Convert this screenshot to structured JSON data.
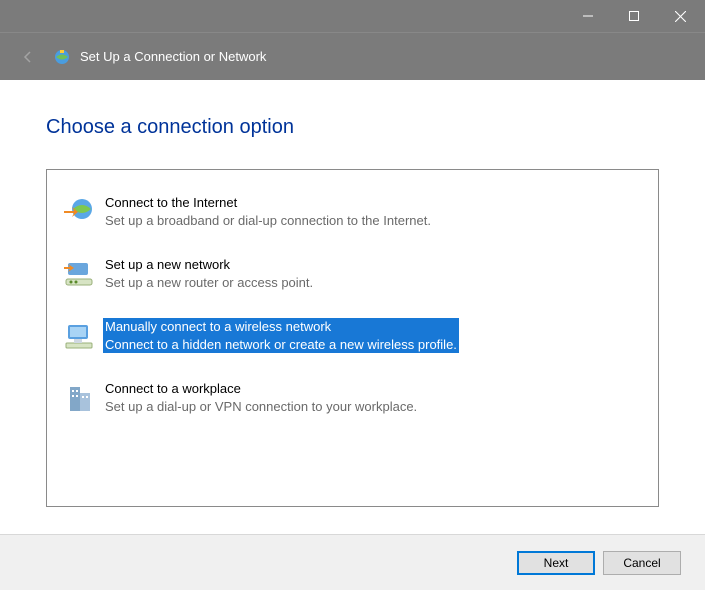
{
  "window": {
    "title": "Set Up a Connection or Network"
  },
  "page": {
    "heading": "Choose a connection option"
  },
  "options": [
    {
      "title": "Connect to the Internet",
      "desc": "Set up a broadband or dial-up connection to the Internet.",
      "selected": false
    },
    {
      "title": "Set up a new network",
      "desc": "Set up a new router or access point.",
      "selected": false
    },
    {
      "title": "Manually connect to a wireless network",
      "desc": "Connect to a hidden network or create a new wireless profile.",
      "selected": true
    },
    {
      "title": "Connect to a workplace",
      "desc": "Set up a dial-up or VPN connection to your workplace.",
      "selected": false
    }
  ],
  "buttons": {
    "next": "Next",
    "cancel": "Cancel"
  }
}
